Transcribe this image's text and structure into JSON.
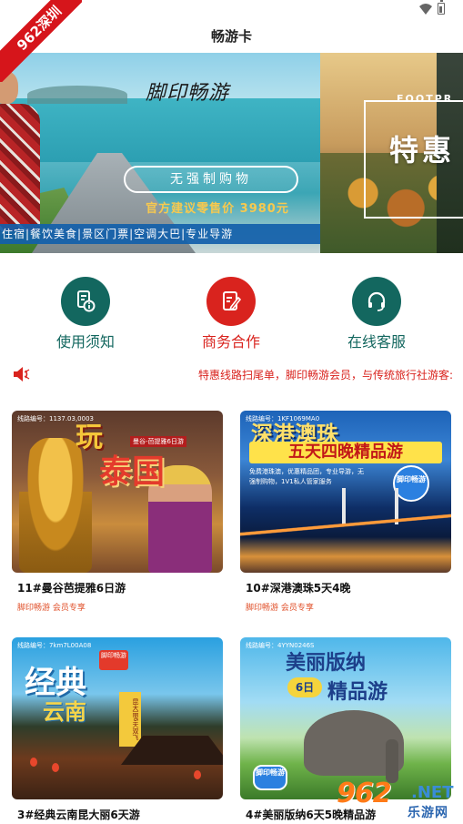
{
  "watermark": {
    "corner": "962深圳",
    "site_big": "962",
    "site_net": ".NET",
    "site_cn": "乐游网"
  },
  "header": {
    "title": "畅游卡"
  },
  "banner": {
    "brand": "脚印畅游",
    "pill": "无强制购物",
    "price": "官方建议零售价 3980元",
    "services": "住宿|餐饮美食|景区门票|空调大巴|专业导游",
    "next_en": "FOOTPR",
    "next_cn": "特惠"
  },
  "actions": [
    {
      "label": "使用须知",
      "icon": "document-info-icon",
      "color": "#13675f"
    },
    {
      "label": "商务合作",
      "icon": "edit-note-icon",
      "color": "#d9231e"
    },
    {
      "label": "在线客服",
      "icon": "headset-icon",
      "color": "#13675f"
    }
  ],
  "notice": {
    "icon": "speaker-icon",
    "text": "特惠线路扫尾单，脚印畅游会员，与传统旅行社游客:"
  },
  "colors": {
    "accent_red": "#d9231e",
    "teal": "#13675f",
    "label_teal": "#13675f"
  },
  "products": [
    {
      "title": "11#曼谷芭提雅6日游",
      "subtitle": "脚印畅游 会员专享",
      "img_line1": "玩",
      "img_line2": "泰国",
      "img_tag": "曼谷-芭提雅6日游",
      "img_code": "线路编号：1137.03,0003"
    },
    {
      "title": "10#深港澳珠5天4晚",
      "subtitle": "脚印畅游 会员专享",
      "img_line1": "深港澳珠",
      "img_line2": "五天四晚精品游",
      "img_desc": "免费港珠澳，优惠精品团，专业导游，无强制购物，1V1私人管家服务",
      "img_badge": "脚印畅游",
      "img_code": "线路编号：1KF1069MA0"
    },
    {
      "title": "3#经典云南昆大丽6天游",
      "subtitle": "",
      "img_line1": "经典",
      "img_line2": "云南",
      "img_badge": "脚印畅游",
      "img_sign": "昆大丽6天双飞",
      "img_code": "线路编号：7km7L00A08"
    },
    {
      "title": "4#美丽版纳6天5晚精品游",
      "subtitle": "",
      "img_line1": "美丽版纳",
      "img_badge6": "6日",
      "img_line2": "精品游",
      "img_logo": "脚印畅游",
      "img_code": "线路编号：4YYN0246S"
    }
  ]
}
